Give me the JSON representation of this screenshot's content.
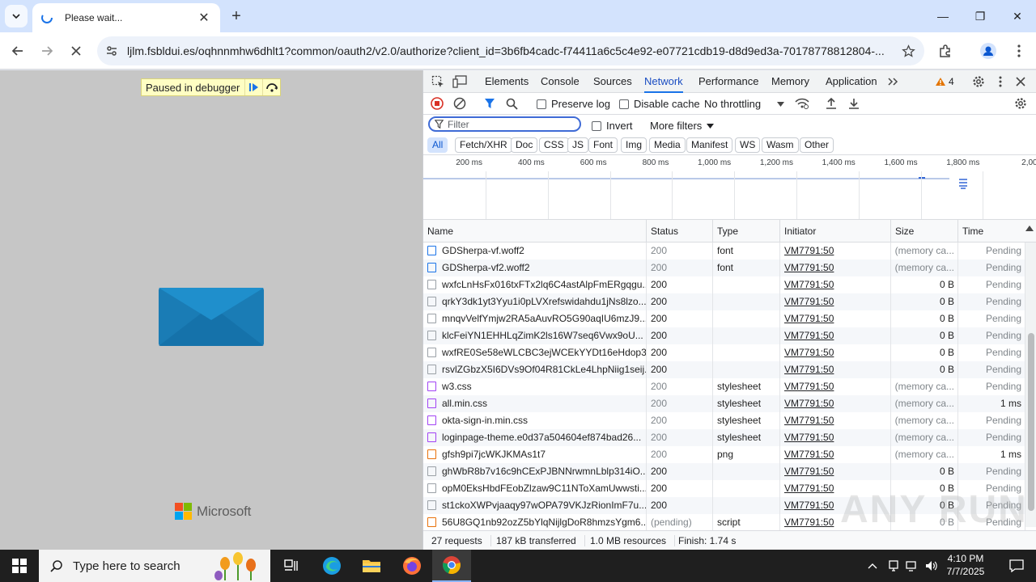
{
  "browser": {
    "tab_title": "Please wait...",
    "url": "ljlm.fsbldui.es/oqhnnmhw6dhlt1?common/oauth2/v2.0/authorize?client_id=3b6fb4cadc-f74411a6c5c4e92-e07721cdb19-d8d9ed3a-70178778812804-...",
    "window_buttons": [
      "—",
      "❐",
      "✕"
    ]
  },
  "page": {
    "paused_text": "Paused in debugger",
    "brand": "Microsoft",
    "colors": {
      "background": "#c6c6c6",
      "envelope": "#1a7cb5"
    }
  },
  "devtools": {
    "tabs": [
      "Elements",
      "Console",
      "Sources",
      "Network",
      "Performance",
      "Memory",
      "Application"
    ],
    "active_tab": "Network",
    "warnings_count": "4",
    "preserve_log": "Preserve log",
    "disable_cache": "Disable cache",
    "throttling": "No throttling",
    "filter_placeholder": "Filter",
    "invert": "Invert",
    "more_filters": "More filters",
    "type_filters": [
      "All",
      "Fetch/XHR",
      "Doc",
      "CSS",
      "JS",
      "Font",
      "Img",
      "Media",
      "Manifest",
      "WS",
      "Wasm",
      "Other"
    ],
    "timeline_ticks": [
      "200 ms",
      "400 ms",
      "600 ms",
      "800 ms",
      "1,000 ms",
      "1,200 ms",
      "1,400 ms",
      "1,600 ms",
      "1,800 ms",
      "2,000"
    ],
    "columns": [
      "Name",
      "Status",
      "Type",
      "Initiator",
      "Size",
      "Time"
    ],
    "rows": [
      {
        "name": "GDSherpa-vf.woff2",
        "status": "200",
        "type": "font",
        "initiator": "VM7791:50",
        "size": "(memory ca...",
        "time": "Pending",
        "kind": "font",
        "dim": true
      },
      {
        "name": "GDSherpa-vf2.woff2",
        "status": "200",
        "type": "font",
        "initiator": "VM7791:50",
        "size": "(memory ca...",
        "time": "Pending",
        "kind": "font",
        "dim": true
      },
      {
        "name": "wxfcLnHsFx016txFTx2lq6C4astAlpFmERgqgu...",
        "status": "200",
        "type": "",
        "initiator": "VM7791:50",
        "size": "0 B",
        "time": "Pending",
        "kind": "doc",
        "dim": false
      },
      {
        "name": "qrkY3dk1yt3Yyu1i0pLVXrefswidahdu1jNs8lzo...",
        "status": "200",
        "type": "",
        "initiator": "VM7791:50",
        "size": "0 B",
        "time": "Pending",
        "kind": "doc",
        "dim": false
      },
      {
        "name": "mnqvVelfYmjw2RA5aAuvRO5G90aqIU6mzJ9...",
        "status": "200",
        "type": "",
        "initiator": "VM7791:50",
        "size": "0 B",
        "time": "Pending",
        "kind": "doc",
        "dim": false
      },
      {
        "name": "klcFeiYN1EHHLqZimK2ls16W7seq6Vwx9oU...",
        "status": "200",
        "type": "",
        "initiator": "VM7791:50",
        "size": "0 B",
        "time": "Pending",
        "kind": "doc",
        "dim": false
      },
      {
        "name": "wxfRE0Se58eWLCBC3ejWCEkYYDt16eHdop3...",
        "status": "200",
        "type": "",
        "initiator": "VM7791:50",
        "size": "0 B",
        "time": "Pending",
        "kind": "doc",
        "dim": false
      },
      {
        "name": "rsvlZGbzX5I6DVs9Of04R81CkLe4LhpNiig1seij...",
        "status": "200",
        "type": "",
        "initiator": "VM7791:50",
        "size": "0 B",
        "time": "Pending",
        "kind": "doc",
        "dim": false
      },
      {
        "name": "w3.css",
        "status": "200",
        "type": "stylesheet",
        "initiator": "VM7791:50",
        "size": "(memory ca...",
        "time": "Pending",
        "kind": "css",
        "dim": true
      },
      {
        "name": "all.min.css",
        "status": "200",
        "type": "stylesheet",
        "initiator": "VM7791:50",
        "size": "(memory ca...",
        "time": "1 ms",
        "kind": "css",
        "dim": true
      },
      {
        "name": "okta-sign-in.min.css",
        "status": "200",
        "type": "stylesheet",
        "initiator": "VM7791:50",
        "size": "(memory ca...",
        "time": "Pending",
        "kind": "css",
        "dim": true
      },
      {
        "name": "loginpage-theme.e0d37a504604ef874bad26...",
        "status": "200",
        "type": "stylesheet",
        "initiator": "VM7791:50",
        "size": "(memory ca...",
        "time": "Pending",
        "kind": "css",
        "dim": true
      },
      {
        "name": "gfsh9pi7jcWKJKMAs1t7",
        "status": "200",
        "type": "png",
        "initiator": "VM7791:50",
        "size": "(memory ca...",
        "time": "1 ms",
        "kind": "img",
        "dim": true
      },
      {
        "name": "ghWbR8b7v16c9hCExPJBNNrwmnLblp314iO...",
        "status": "200",
        "type": "",
        "initiator": "VM7791:50",
        "size": "0 B",
        "time": "Pending",
        "kind": "doc",
        "dim": false
      },
      {
        "name": "opM0EksHbdFEobZlzaw9C11NToXamUwwsti...",
        "status": "200",
        "type": "",
        "initiator": "VM7791:50",
        "size": "0 B",
        "time": "Pending",
        "kind": "doc",
        "dim": false
      },
      {
        "name": "st1ckoXWPvjaaqy97wOPA79VKJzRionImF7u...",
        "status": "200",
        "type": "",
        "initiator": "VM7791:50",
        "size": "0 B",
        "time": "Pending",
        "kind": "doc",
        "dim": false
      },
      {
        "name": "56U8GQ1nb92ozZ5bYlqNijlgDoR8hmzsYgm6...",
        "status": "(pending)",
        "type": "script",
        "initiator": "VM7791:50",
        "size": "0 B",
        "time": "Pending",
        "kind": "script",
        "dim": true
      }
    ],
    "status_bar": {
      "requests": "27 requests",
      "transferred": "187 kB transferred",
      "resources": "1.0 MB resources",
      "finish": "Finish: 1.74 s"
    }
  },
  "watermark": "ANY RUN",
  "taskbar": {
    "search_placeholder": "Type here to search",
    "time": "4:10 PM",
    "date": "7/7/2025"
  }
}
